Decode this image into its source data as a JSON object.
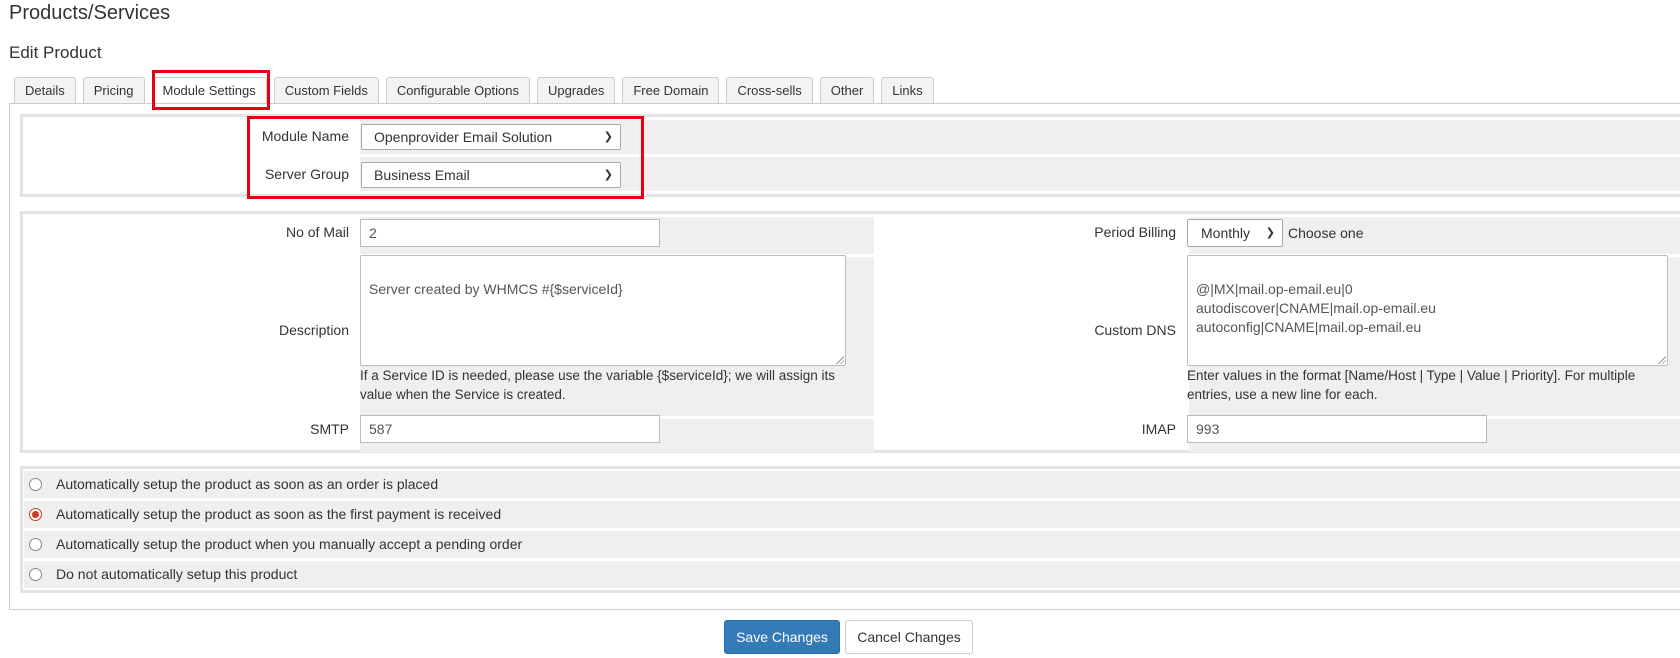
{
  "page": {
    "title": "Products/Services",
    "subtitle": "Edit Product"
  },
  "tabs": [
    {
      "label": "Details"
    },
    {
      "label": "Pricing"
    },
    {
      "label": "Module Settings",
      "active": true
    },
    {
      "label": "Custom Fields"
    },
    {
      "label": "Configurable Options"
    },
    {
      "label": "Upgrades"
    },
    {
      "label": "Free Domain"
    },
    {
      "label": "Cross-sells"
    },
    {
      "label": "Other"
    },
    {
      "label": "Links"
    }
  ],
  "module": {
    "module_name_label": "Module Name",
    "module_name_value": "Openprovider Email Solution",
    "server_group_label": "Server Group",
    "server_group_value": "Business Email"
  },
  "config": {
    "no_of_mail_label": "No of Mail",
    "no_of_mail_value": "2",
    "period_billing_label": "Period Billing",
    "period_billing_value": "Monthly",
    "period_billing_help": "Choose one",
    "description_label": "Description",
    "description_value": "Server created by WHMCS #{$serviceId}",
    "description_help": "If a Service ID is needed, please use the variable {$serviceId}; we will assign its value when the Service is created.",
    "custom_dns_label": "Custom DNS",
    "custom_dns_value": "@|MX|mail.op-email.eu|0\nautodiscover|CNAME|mail.op-email.eu\nautoconfig|CNAME|mail.op-email.eu",
    "custom_dns_help": "Enter values in the format [Name/Host | Type | Value | Priority]. For multiple entries, use a new line for each.",
    "smtp_label": "SMTP",
    "smtp_value": "587",
    "imap_label": "IMAP",
    "imap_value": "993"
  },
  "setup_options": [
    {
      "label": "Automatically setup the product as soon as an order is placed",
      "checked": false
    },
    {
      "label": "Automatically setup the product as soon as the first payment is received",
      "checked": true
    },
    {
      "label": "Automatically setup the product when you manually accept a pending order",
      "checked": false
    },
    {
      "label": "Do not automatically setup this product",
      "checked": false
    }
  ],
  "buttons": {
    "save": "Save Changes",
    "cancel": "Cancel Changes"
  },
  "colors": {
    "highlight": "#e60012",
    "primary": "#337ab7",
    "radio_checked": "#cc3a22"
  }
}
